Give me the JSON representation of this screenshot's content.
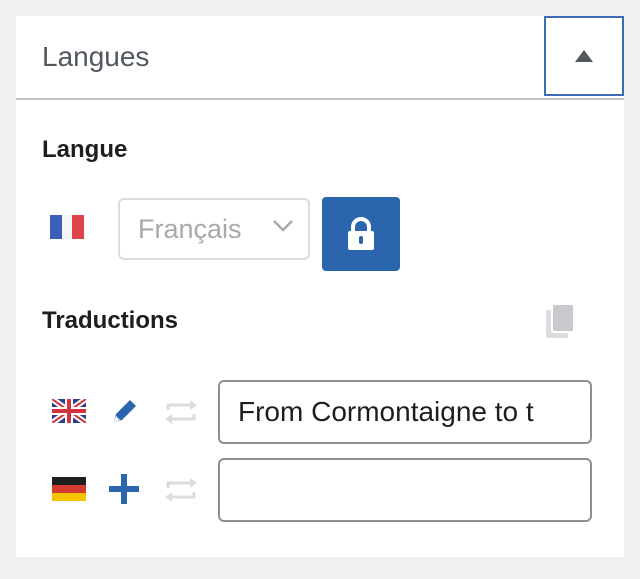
{
  "panel": {
    "title": "Langues",
    "toggle_icon": "triangle-up-icon"
  },
  "language": {
    "label": "Langue",
    "flag": "fr-flag-icon",
    "select_value": "Français",
    "lock_icon": "lock-icon"
  },
  "translations": {
    "label": "Traductions",
    "copy_icon": "copy-icon",
    "rows": [
      {
        "flag": "uk-flag-icon",
        "action_icon": "pencil-icon",
        "sync_icon": "sync-icon",
        "value": "From Cormontaigne to t",
        "placeholder": ""
      },
      {
        "flag": "de-flag-icon",
        "action_icon": "plus-icon",
        "sync_icon": "sync-icon",
        "value": "",
        "placeholder": ""
      }
    ]
  },
  "colors": {
    "accent": "#2a65ad",
    "muted_icon": "#dcdcde",
    "label_grey": "#50575e"
  }
}
